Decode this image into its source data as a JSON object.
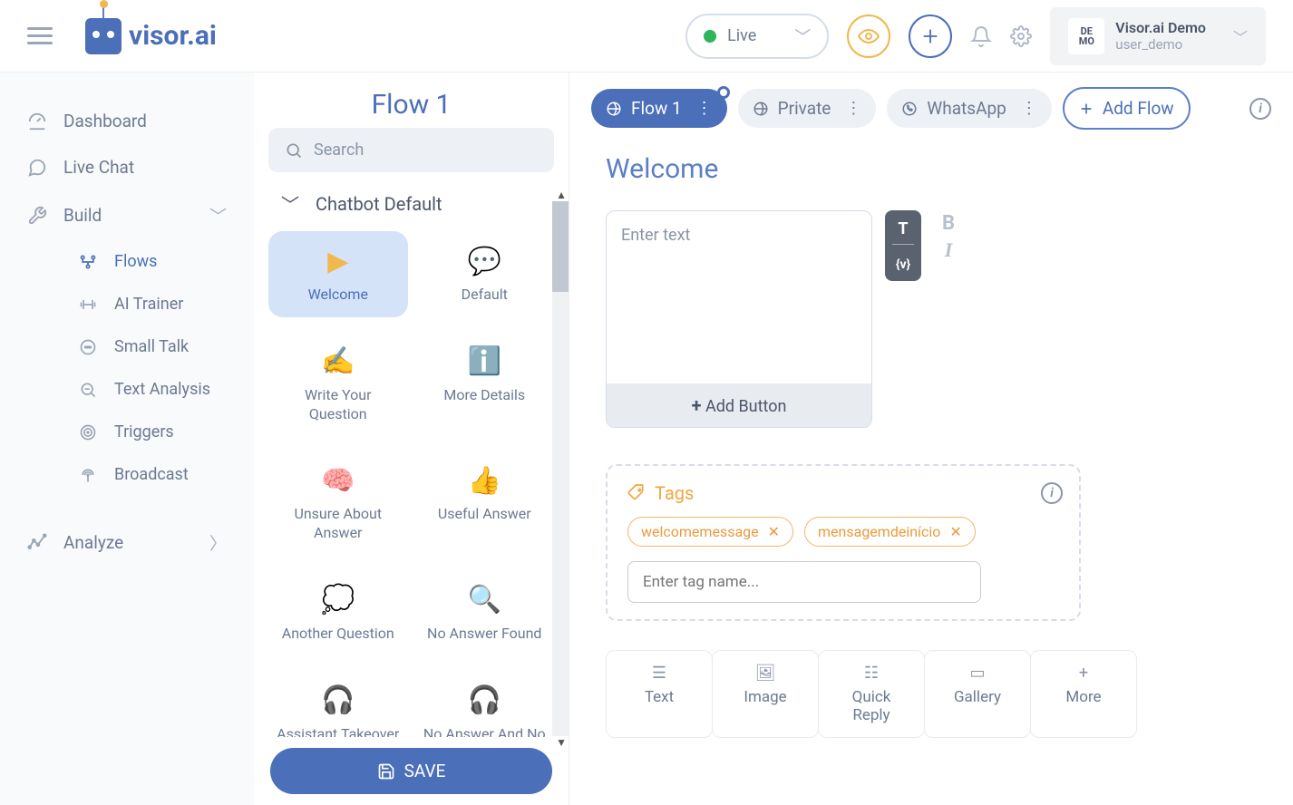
{
  "brand": "visor.ai",
  "header": {
    "status": "Live",
    "account_title": "Visor.ai Demo",
    "account_sub": "user_demo",
    "avatar_text_1": "DE",
    "avatar_text_2": "MO"
  },
  "sidebar": {
    "dashboard": "Dashboard",
    "live_chat": "Live Chat",
    "build": "Build",
    "flows": "Flows",
    "ai_trainer": "AI Trainer",
    "small_talk": "Small Talk",
    "text_analysis": "Text Analysis",
    "triggers": "Triggers",
    "broadcast": "Broadcast",
    "analyze": "Analyze"
  },
  "flows_panel": {
    "title": "Flow 1",
    "search_placeholder": "Search",
    "category": "Chatbot Default",
    "cards": {
      "welcome": "Welcome",
      "default": "Default",
      "write_question": "Write Your Question",
      "more_details": "More Details",
      "unsure": "Unsure About Answer",
      "useful": "Useful Answer",
      "another": "Another Question",
      "no_answer": "No Answer Found",
      "takeover": "Assistant Takeover",
      "no_assist": "No Answer And No Assistant"
    },
    "save": "SAVE"
  },
  "flow_tabs": {
    "t1": "Flow 1",
    "t2": "Private",
    "t3": "WhatsApp",
    "add": "Add Flow"
  },
  "canvas": {
    "title": "Welcome",
    "text_placeholder": "Enter text",
    "add_button": "Add Button",
    "fmt_T": "T",
    "fmt_V": "{v}",
    "fmt_B": "B",
    "fmt_I": "I",
    "tags_label": "Tags",
    "tag1": "welcomemessage",
    "tag2": "mensagemdeinício",
    "tag_placeholder": "Enter tag name...",
    "types": {
      "text": "Text",
      "image": "Image",
      "quick_reply": "Quick Reply",
      "gallery": "Gallery",
      "more": "More"
    }
  }
}
